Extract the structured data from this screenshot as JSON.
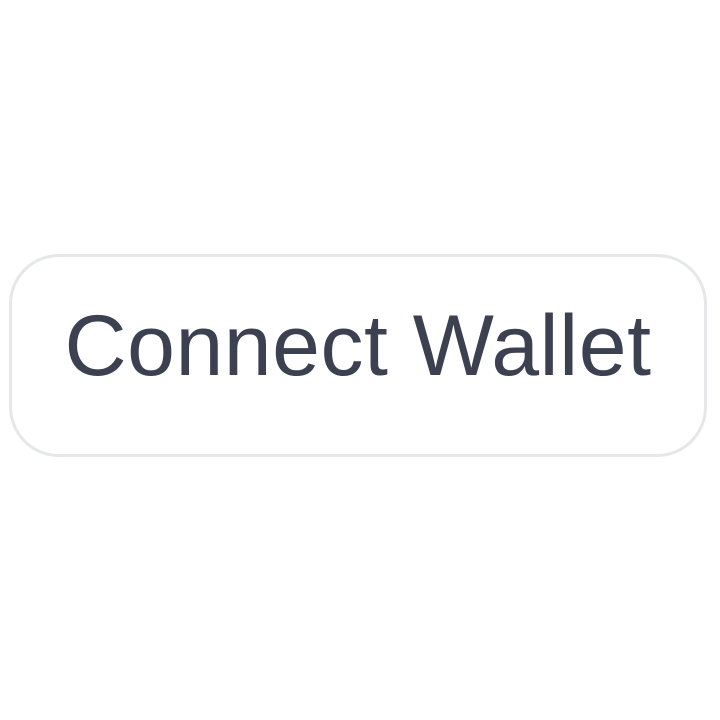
{
  "wallet_button": {
    "label": "Connect Wallet"
  },
  "colors": {
    "background": "#ffffff",
    "button_border": "#e6e7e9",
    "button_text": "#3b4150"
  }
}
